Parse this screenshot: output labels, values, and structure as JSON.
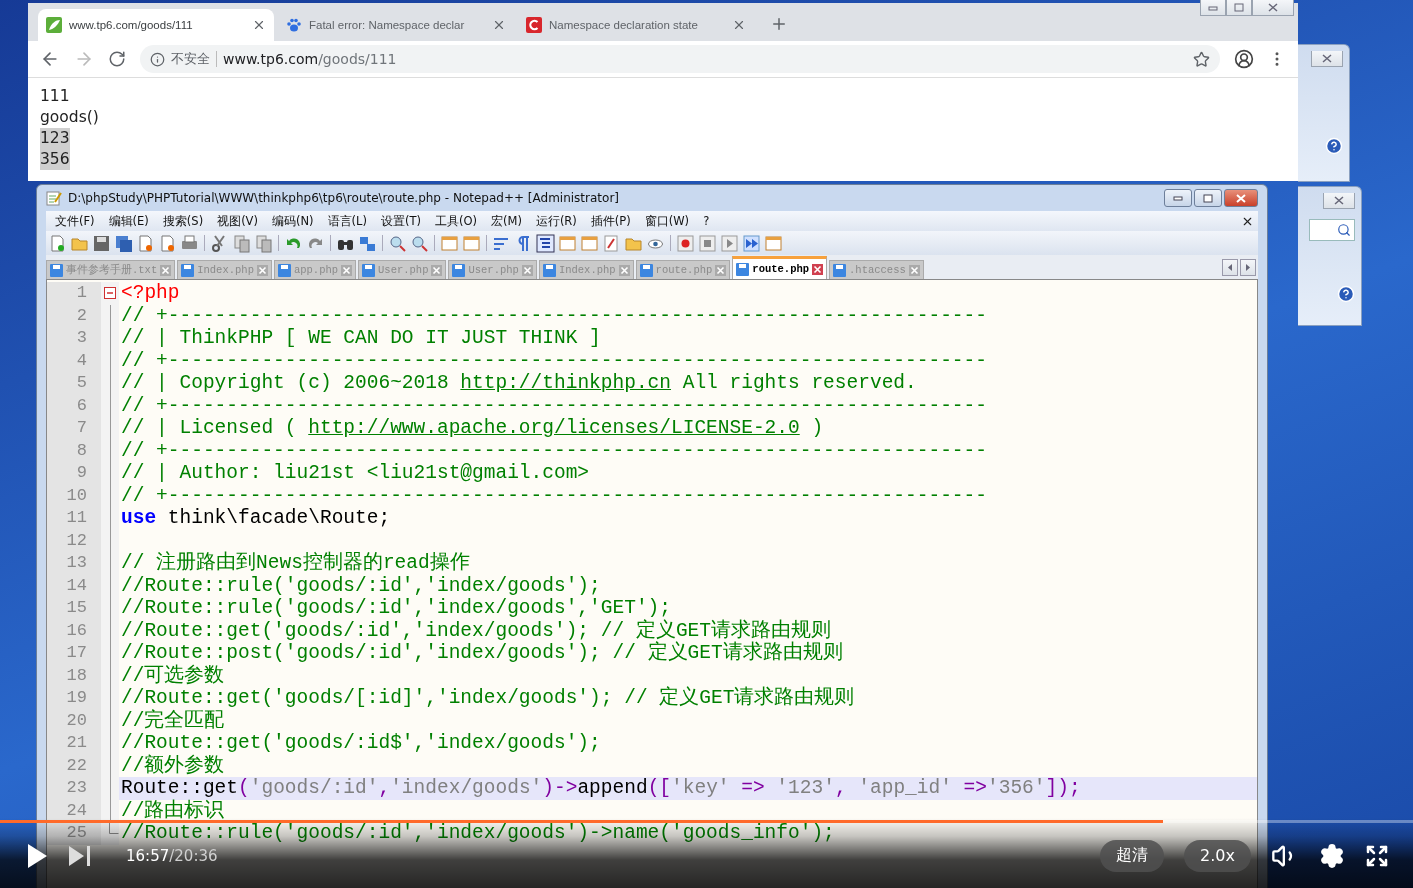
{
  "browser": {
    "tabs": [
      {
        "title": "www.tp6.com/goods/111",
        "selected": true
      },
      {
        "title": "Fatal error: Namespace declar",
        "selected": false
      },
      {
        "title": "Namespace declaration state",
        "selected": false
      }
    ],
    "address": {
      "security": "不安全",
      "host": "www.tp6.com",
      "path": "/goods/111"
    },
    "page_lines": [
      {
        "text": "111",
        "selected": false
      },
      {
        "text": "goods()",
        "selected": false
      },
      {
        "text": "123",
        "selected": true
      },
      {
        "text": "356",
        "selected": true
      }
    ]
  },
  "editor": {
    "title": "D:\\phpStudy\\PHPTutorial\\WWW\\thinkphp6\\tp6\\route\\route.php - Notepad++ [Administrator]",
    "menu": [
      "文件(F)",
      "编辑(E)",
      "搜索(S)",
      "视图(V)",
      "编码(N)",
      "语言(L)",
      "设置(T)",
      "工具(O)",
      "宏(M)",
      "运行(R)",
      "插件(P)",
      "窗口(W)",
      "?"
    ],
    "tabs": [
      {
        "label": "事件参考手册.txt",
        "selected": false
      },
      {
        "label": "Index.php",
        "selected": false
      },
      {
        "label": "app.php",
        "selected": false
      },
      {
        "label": "User.php",
        "selected": false
      },
      {
        "label": "User.php",
        "selected": false
      },
      {
        "label": "Index.php",
        "selected": false
      },
      {
        "label": "route.php",
        "selected": false
      },
      {
        "label": "route.php",
        "selected": true
      },
      {
        "label": ".htaccess",
        "selected": false
      }
    ],
    "lines": [
      {
        "number": "1",
        "fold_start": true,
        "fold_end": false,
        "current": false,
        "segments": [
          {
            "kind": "tag",
            "text": "<?php"
          }
        ]
      },
      {
        "number": "2",
        "fold_start": false,
        "fold_end": false,
        "current": false,
        "segments": [
          {
            "kind": "comment",
            "text": "// +----------------------------------------------------------------------"
          }
        ]
      },
      {
        "number": "3",
        "fold_start": false,
        "fold_end": false,
        "current": false,
        "segments": [
          {
            "kind": "comment",
            "text": "// | ThinkPHP [ WE CAN DO IT JUST THINK ]"
          }
        ]
      },
      {
        "number": "4",
        "fold_start": false,
        "fold_end": false,
        "current": false,
        "segments": [
          {
            "kind": "comment",
            "text": "// +----------------------------------------------------------------------"
          }
        ]
      },
      {
        "number": "5",
        "fold_start": false,
        "fold_end": false,
        "current": false,
        "segments": [
          {
            "kind": "comment",
            "text": "// | Copyright (c) 2006~2018 "
          },
          {
            "kind": "link",
            "text": "http://thinkphp.cn"
          },
          {
            "kind": "comment",
            "text": " All rights reserved."
          }
        ]
      },
      {
        "number": "6",
        "fold_start": false,
        "fold_end": false,
        "current": false,
        "segments": [
          {
            "kind": "comment",
            "text": "// +----------------------------------------------------------------------"
          }
        ]
      },
      {
        "number": "7",
        "fold_start": false,
        "fold_end": false,
        "current": false,
        "segments": [
          {
            "kind": "comment",
            "text": "// | Licensed ( "
          },
          {
            "kind": "link",
            "text": "http://www.apache.org/licenses/LICENSE-2.0"
          },
          {
            "kind": "comment",
            "text": " )"
          }
        ]
      },
      {
        "number": "8",
        "fold_start": false,
        "fold_end": false,
        "current": false,
        "segments": [
          {
            "kind": "comment",
            "text": "// +----------------------------------------------------------------------"
          }
        ]
      },
      {
        "number": "9",
        "fold_start": false,
        "fold_end": false,
        "current": false,
        "segments": [
          {
            "kind": "comment",
            "text": "// | Author: liu21st <liu21st@gmail.com>"
          }
        ]
      },
      {
        "number": "10",
        "fold_start": false,
        "fold_end": false,
        "current": false,
        "segments": [
          {
            "kind": "comment",
            "text": "// +----------------------------------------------------------------------"
          }
        ]
      },
      {
        "number": "11",
        "fold_start": false,
        "fold_end": false,
        "current": false,
        "segments": [
          {
            "kind": "keyword",
            "text": "use"
          },
          {
            "kind": "plain",
            "text": " think\\facade\\Route;"
          }
        ]
      },
      {
        "number": "12",
        "fold_start": false,
        "fold_end": false
      },
      {
        "number": "13",
        "fold_start": false,
        "fold_end": false,
        "current": false,
        "segments": [
          {
            "kind": "comment",
            "text": "// 注册路由到News控制器的read操作"
          }
        ]
      },
      {
        "number": "14",
        "fold_start": false,
        "fold_end": false,
        "current": false,
        "segments": [
          {
            "kind": "comment",
            "text": "//Route::rule('goods/:id','index/goods');"
          }
        ]
      },
      {
        "number": "15",
        "fold_start": false,
        "fold_end": false,
        "current": false,
        "segments": [
          {
            "kind": "comment",
            "text": "//Route::rule('goods/:id','index/goods','GET');"
          }
        ]
      },
      {
        "number": "16",
        "fold_start": false,
        "fold_end": false,
        "current": false,
        "segments": [
          {
            "kind": "comment",
            "text": "//Route::get('goods/:id','index/goods'); // 定义GET请求路由规则"
          }
        ]
      },
      {
        "number": "17",
        "fold_start": false,
        "fold_end": false,
        "current": false,
        "segments": [
          {
            "kind": "comment",
            "text": "//Route::post('goods/:id','index/goods'); // 定义GET请求路由规则"
          }
        ]
      },
      {
        "number": "18",
        "fold_start": false,
        "fold_end": false,
        "current": false,
        "segments": [
          {
            "kind": "comment",
            "text": "//可选参数"
          }
        ]
      },
      {
        "number": "19",
        "fold_start": false,
        "fold_end": false,
        "current": false,
        "segments": [
          {
            "kind": "comment",
            "text": "//Route::get('goods/[:id]','index/goods'); // 定义GET请求路由规则"
          }
        ]
      },
      {
        "number": "20",
        "fold_start": false,
        "fold_end": false,
        "current": false,
        "segments": [
          {
            "kind": "comment",
            "text": "//完全匹配"
          }
        ]
      },
      {
        "number": "21",
        "fold_start": false,
        "fold_end": false,
        "current": false,
        "segments": [
          {
            "kind": "comment",
            "text": "//Route::get('goods/:id$','index/goods');"
          }
        ]
      },
      {
        "number": "22",
        "fold_start": false,
        "fold_end": false,
        "current": false,
        "segments": [
          {
            "kind": "comment",
            "text": "//额外参数"
          }
        ]
      },
      {
        "number": "23",
        "fold_start": false,
        "fold_end": false,
        "current": true,
        "segments": [
          {
            "kind": "plain",
            "text": "Route::get"
          },
          {
            "kind": "op",
            "text": "("
          },
          {
            "kind": "string",
            "text": "'goods/:id'"
          },
          {
            "kind": "op",
            "text": ","
          },
          {
            "kind": "string",
            "text": "'index/goods'"
          },
          {
            "kind": "op",
            "text": ")->"
          },
          {
            "kind": "plain",
            "text": "append"
          },
          {
            "kind": "op",
            "text": "(["
          },
          {
            "kind": "string",
            "text": "'key'"
          },
          {
            "kind": "op",
            "text": " => "
          },
          {
            "kind": "string",
            "text": "'123'"
          },
          {
            "kind": "op",
            "text": ", "
          },
          {
            "kind": "string",
            "text": "'app_id'"
          },
          {
            "kind": "op",
            "text": " =>"
          },
          {
            "kind": "string",
            "text": "'356'"
          },
          {
            "kind": "op",
            "text": "]);"
          }
        ]
      },
      {
        "number": "24",
        "fold_start": false,
        "fold_end": false,
        "current": false,
        "segments": [
          {
            "kind": "comment",
            "text": "//路由标识"
          }
        ]
      },
      {
        "number": "25",
        "fold_start": false,
        "fold_end": true,
        "current": false,
        "segments": [
          {
            "kind": "comment",
            "text": "//Route::rule('goods/:id','index/goods')->name('goods_info');"
          }
        ]
      }
    ]
  },
  "player": {
    "progress": {
      "level": 0.823
    },
    "current_time": "16:57",
    "duration": "/20:36",
    "quality": "超清",
    "speed": "2.0x"
  }
}
